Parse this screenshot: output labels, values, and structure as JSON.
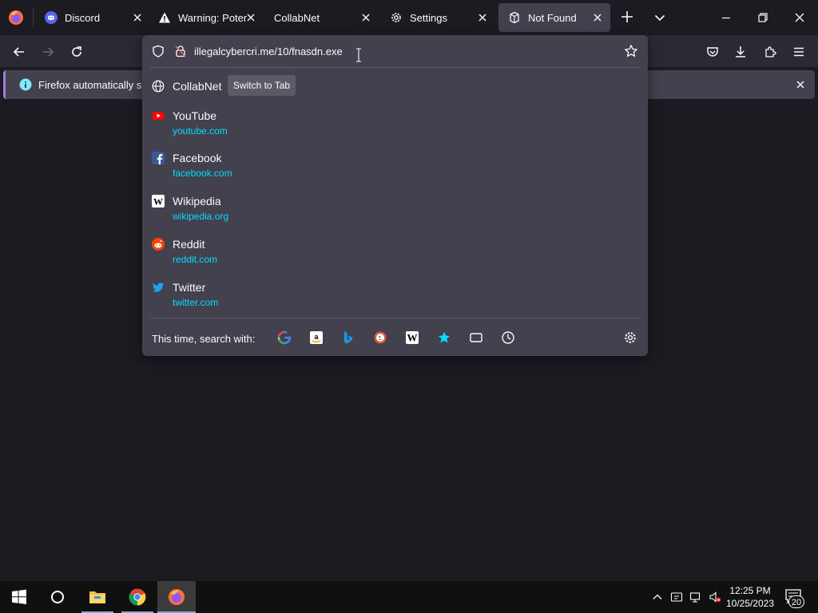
{
  "tabs": [
    {
      "title": "Discord",
      "favicon": "discord-icon",
      "active": false
    },
    {
      "title": "Warning: Potent",
      "favicon": "warning-icon",
      "active": false
    },
    {
      "title": "CollabNet",
      "favicon": "",
      "active": false
    },
    {
      "title": "Settings",
      "favicon": "gear-icon",
      "active": false
    },
    {
      "title": "Not Found",
      "favicon": "not-found-icon",
      "active": true
    }
  ],
  "urlbar": {
    "value": "illegalcybercri.me/10/fnasdn.exe"
  },
  "notification": {
    "text": "Firefox automatically sen"
  },
  "popup": {
    "switch_row": {
      "title": "CollabNet",
      "button": "Switch to Tab"
    },
    "top_sites": [
      {
        "title": "YouTube",
        "url": "youtube.com",
        "icon": "youtube-icon"
      },
      {
        "title": "Facebook",
        "url": "facebook.com",
        "icon": "facebook-icon"
      },
      {
        "title": "Wikipedia",
        "url": "wikipedia.org",
        "icon": "wikipedia-icon"
      },
      {
        "title": "Reddit",
        "url": "reddit.com",
        "icon": "reddit-icon"
      },
      {
        "title": "Twitter",
        "url": "twitter.com",
        "icon": "twitter-icon"
      }
    ],
    "search_with_label": "This time, search with:",
    "engines": [
      "google-icon",
      "amazon-icon",
      "bing-icon",
      "duckduckgo-icon",
      "wikipedia-icon",
      "bookmarks-icon",
      "tabs-icon",
      "history-icon"
    ]
  },
  "taskbar": {
    "time": "12:25 PM",
    "date": "10/25/2023",
    "notification_count": "20"
  },
  "colors": {
    "accent_link": "#00ddff",
    "panel": "#42414d",
    "toolbar": "#2b2a33",
    "background": "#1c1b22"
  }
}
